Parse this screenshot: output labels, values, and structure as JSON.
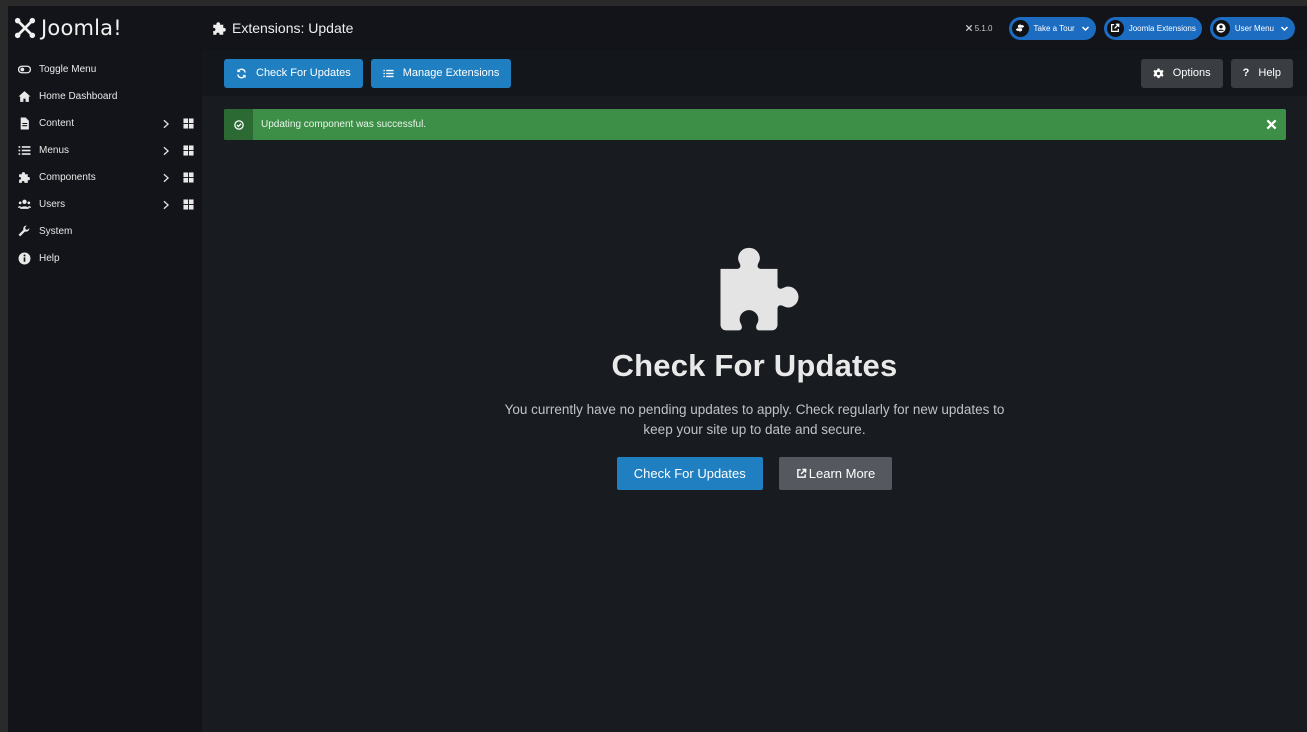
{
  "brand": {
    "name": "Joomla!"
  },
  "header": {
    "page_title": "Extensions: Update",
    "version": "5.1.0",
    "take_tour": "Take a Tour",
    "joomla_extensions": "Joomla Extensions",
    "user_menu": "User Menu"
  },
  "sidebar": {
    "items": [
      {
        "label": "Toggle Menu",
        "icon": "toggle-icon"
      },
      {
        "label": "Home Dashboard",
        "icon": "home-icon"
      },
      {
        "label": "Content",
        "icon": "file-icon"
      },
      {
        "label": "Menus",
        "icon": "list-icon"
      },
      {
        "label": "Components",
        "icon": "puzzle-icon"
      },
      {
        "label": "Users",
        "icon": "users-icon"
      },
      {
        "label": "System",
        "icon": "wrench-icon"
      },
      {
        "label": "Help",
        "icon": "info-icon"
      }
    ]
  },
  "toolbar": {
    "check_updates": "Check For Updates",
    "manage_extensions": "Manage Extensions",
    "options": "Options",
    "help": "Help"
  },
  "alert": {
    "message": "Updating component was successful.",
    "color": "#3d8f47"
  },
  "empty_state": {
    "title": "Check For Updates",
    "description": "You currently have no pending updates to apply. Check regularly for new updates to keep your site up to date and secure.",
    "primary_button": "Check For Updates",
    "secondary_button": "Learn More"
  },
  "colors": {
    "accent": "#1f7fc1",
    "background": "#181b20",
    "sidebar": "#121419"
  }
}
